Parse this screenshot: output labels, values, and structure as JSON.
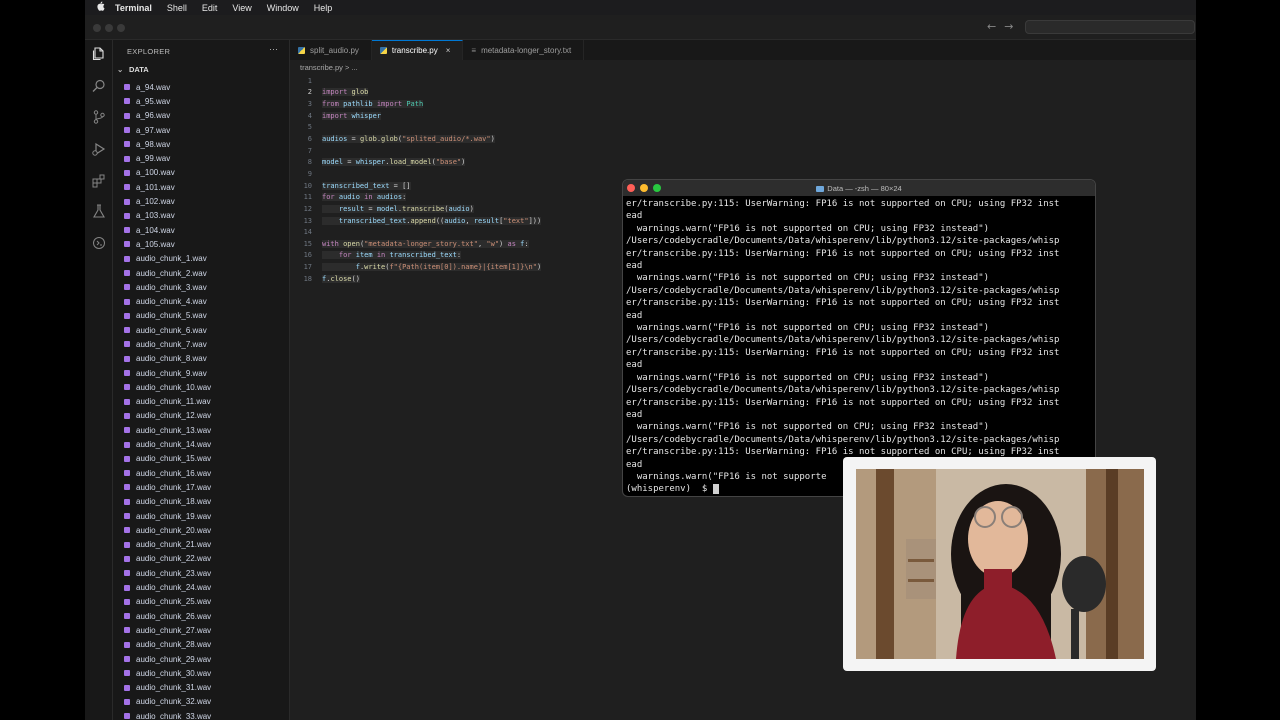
{
  "menubar": {
    "app": "Terminal",
    "items": [
      "Shell",
      "Edit",
      "View",
      "Window",
      "Help"
    ]
  },
  "sidebar": {
    "header": "EXPLORER",
    "more": "···",
    "folder": "DATA",
    "files": [
      "a_94.wav",
      "a_95.wav",
      "a_96.wav",
      "a_97.wav",
      "a_98.wav",
      "a_99.wav",
      "a_100.wav",
      "a_101.wav",
      "a_102.wav",
      "a_103.wav",
      "a_104.wav",
      "a_105.wav",
      "audio_chunk_1.wav",
      "audio_chunk_2.wav",
      "audio_chunk_3.wav",
      "audio_chunk_4.wav",
      "audio_chunk_5.wav",
      "audio_chunk_6.wav",
      "audio_chunk_7.wav",
      "audio_chunk_8.wav",
      "audio_chunk_9.wav",
      "audio_chunk_10.wav",
      "audio_chunk_11.wav",
      "audio_chunk_12.wav",
      "audio_chunk_13.wav",
      "audio_chunk_14.wav",
      "audio_chunk_15.wav",
      "audio_chunk_16.wav",
      "audio_chunk_17.wav",
      "audio_chunk_18.wav",
      "audio_chunk_19.wav",
      "audio_chunk_20.wav",
      "audio_chunk_21.wav",
      "audio_chunk_22.wav",
      "audio_chunk_23.wav",
      "audio_chunk_24.wav",
      "audio_chunk_25.wav",
      "audio_chunk_26.wav",
      "audio_chunk_27.wav",
      "audio_chunk_28.wav",
      "audio_chunk_29.wav",
      "audio_chunk_30.wav",
      "audio_chunk_31.wav",
      "audio_chunk_32.wav",
      "audio_chunk_33.wav"
    ]
  },
  "tabs": [
    {
      "label": "split_audio.py",
      "icon": "python-file-icon",
      "active": false
    },
    {
      "label": "transcribe.py",
      "icon": "python-file-icon",
      "active": true
    },
    {
      "label": "metadata-longer_story.txt",
      "icon": "text-file-icon",
      "active": false
    }
  ],
  "tab_close": "×",
  "breadcrumb": "transcribe.py > ...",
  "code": [
    {
      "n": "1",
      "text": ""
    },
    {
      "n": "2",
      "text": "import glob"
    },
    {
      "n": "3",
      "text": "from pathlib import Path"
    },
    {
      "n": "4",
      "text": "import whisper"
    },
    {
      "n": "5",
      "text": ""
    },
    {
      "n": "6",
      "text": "audios = glob.glob(\"splited_audio/*.wav\")"
    },
    {
      "n": "7",
      "text": ""
    },
    {
      "n": "8",
      "text": "model = whisper.load_model(\"base\")"
    },
    {
      "n": "9",
      "text": ""
    },
    {
      "n": "10",
      "text": "transcribed_text = []"
    },
    {
      "n": "11",
      "text": "for audio in audios:"
    },
    {
      "n": "12",
      "text": "    result = model.transcribe(audio)"
    },
    {
      "n": "13",
      "text": "    transcribed_text.append((audio, result[\"text\"]))"
    },
    {
      "n": "14",
      "text": ""
    },
    {
      "n": "15",
      "text": "with open(\"metadata-longer_story.txt\", \"w\") as f:"
    },
    {
      "n": "16",
      "text": "    for item in transcribed_text:"
    },
    {
      "n": "17",
      "text": "        f.write(f\"{Path(item[0]).name}|{item[1]}\\n\")"
    },
    {
      "n": "18",
      "text": "f.close()"
    }
  ],
  "terminal": {
    "title": "Data — -zsh — 80×24",
    "lines": [
      "er/transcribe.py:115: UserWarning: FP16 is not supported on CPU; using FP32 inst",
      "ead",
      "  warnings.warn(\"FP16 is not supported on CPU; using FP32 instead\")",
      "/Users/codebycradle/Documents/Data/whisperenv/lib/python3.12/site-packages/whisp",
      "er/transcribe.py:115: UserWarning: FP16 is not supported on CPU; using FP32 inst",
      "ead",
      "  warnings.warn(\"FP16 is not supported on CPU; using FP32 instead\")",
      "/Users/codebycradle/Documents/Data/whisperenv/lib/python3.12/site-packages/whisp",
      "er/transcribe.py:115: UserWarning: FP16 is not supported on CPU; using FP32 inst",
      "ead",
      "  warnings.warn(\"FP16 is not supported on CPU; using FP32 instead\")",
      "/Users/codebycradle/Documents/Data/whisperenv/lib/python3.12/site-packages/whisp",
      "er/transcribe.py:115: UserWarning: FP16 is not supported on CPU; using FP32 inst",
      "ead",
      "  warnings.warn(\"FP16 is not supported on CPU; using FP32 instead\")",
      "/Users/codebycradle/Documents/Data/whisperenv/lib/python3.12/site-packages/whisp",
      "er/transcribe.py:115: UserWarning: FP16 is not supported on CPU; using FP32 inst",
      "ead",
      "  warnings.warn(\"FP16 is not supported on CPU; using FP32 instead\")",
      "/Users/codebycradle/Documents/Data/whisperenv/lib/python3.12/site-packages/whisp",
      "er/transcribe.py:115: UserWarning: FP16 is not supported on CPU; using FP32 inst",
      "ead",
      "  warnings.warn(\"FP16 is not supporte"
    ],
    "prompt": "(whisperenv)  $"
  },
  "colors": {
    "accent": "#0078d4",
    "wav_icon": "#a472e8",
    "close_dot": "#ff5f57",
    "min_dot": "#febc2e",
    "max_dot": "#28c840"
  }
}
